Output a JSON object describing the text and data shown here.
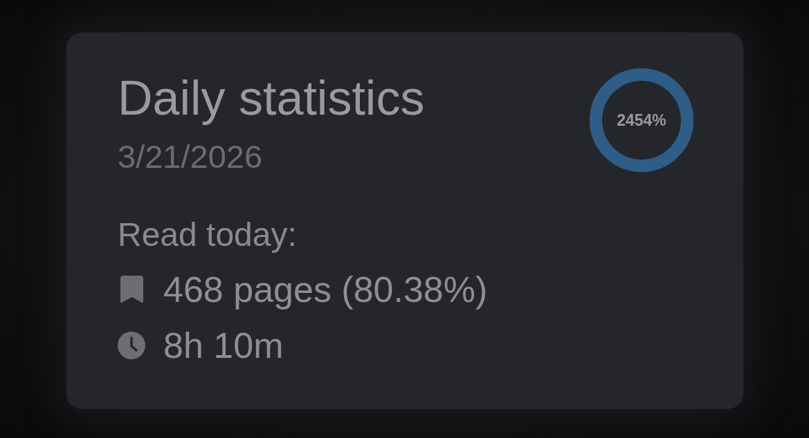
{
  "card": {
    "title": "Daily statistics",
    "date": "3/21/2026",
    "progress": {
      "reading": "2454%",
      "level": 1
    },
    "section_label": "Read today:",
    "stats": [
      {
        "kind": "pages",
        "text": "468 pages (80.38%)"
      },
      {
        "kind": "time",
        "text": "8h 10m"
      }
    ]
  }
}
